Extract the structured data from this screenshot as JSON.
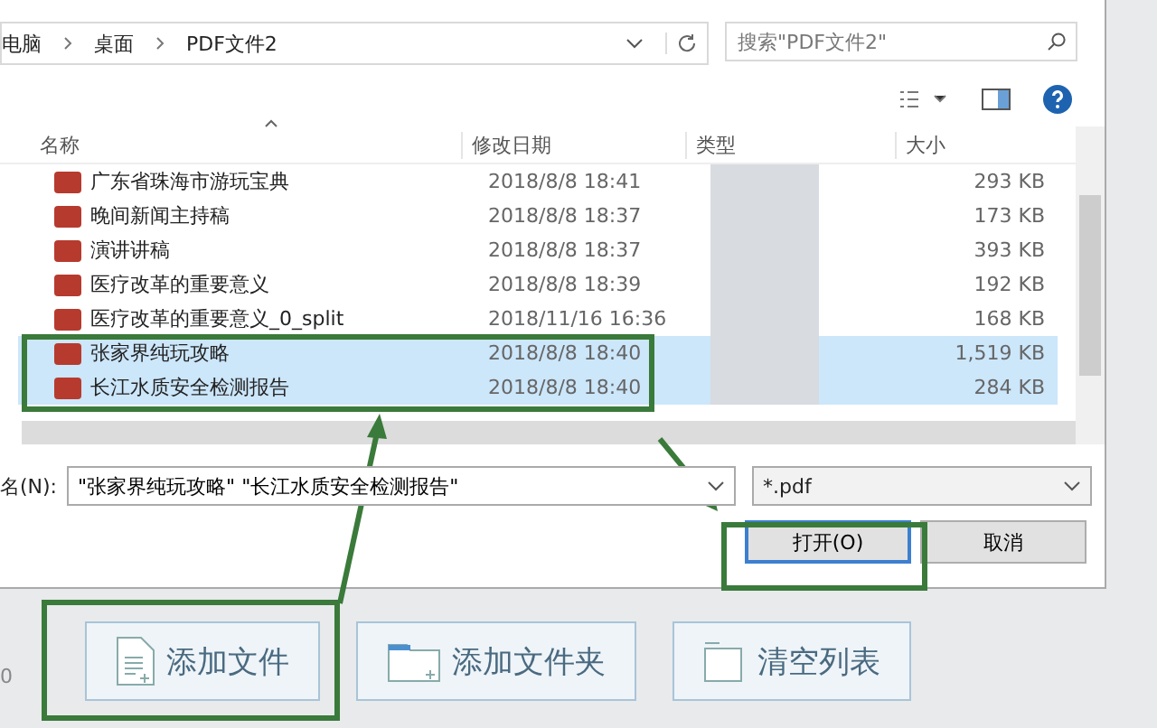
{
  "address_bar": {
    "crumbs": [
      "电脑",
      "桌面",
      "PDF文件2"
    ]
  },
  "search": {
    "placeholder": "搜索\"PDF文件2\""
  },
  "table": {
    "columns": [
      "名称",
      "修改日期",
      "类型",
      "大小"
    ],
    "rows": [
      {
        "name": "广东省珠海市游玩宝典",
        "modified": "2018/8/8 18:41",
        "size": "293 KB",
        "selected": false
      },
      {
        "name": "晚间新闻主持稿",
        "modified": "2018/8/8 18:37",
        "size": "173 KB",
        "selected": false
      },
      {
        "name": "演讲讲稿",
        "modified": "2018/8/8 18:37",
        "size": "393 KB",
        "selected": false
      },
      {
        "name": "医疗改革的重要意义",
        "modified": "2018/8/8 18:39",
        "size": "192 KB",
        "selected": false
      },
      {
        "name": "医疗改革的重要意义_0_split",
        "modified": "2018/11/16 16:36",
        "size": "168 KB",
        "selected": false
      },
      {
        "name": "张家界纯玩攻略",
        "modified": "2018/8/8 18:40",
        "size": "1,519 KB",
        "selected": true
      },
      {
        "name": "长江水质安全检测报告",
        "modified": "2018/8/8 18:40",
        "size": "284 KB",
        "selected": true
      }
    ]
  },
  "file_name": {
    "label": "名(N):",
    "value": "\"张家界纯玩攻略\" \"长江水质安全检测报告\""
  },
  "file_type": {
    "value": "*.pdf"
  },
  "dialog_buttons": [
    "打开(O)",
    "取消"
  ],
  "side_text": "0",
  "app_buttons": [
    {
      "label": "添加文件",
      "kind": "file"
    },
    {
      "label": "添加文件夹",
      "kind": "folder"
    },
    {
      "label": "清空列表",
      "kind": "clear"
    }
  ]
}
